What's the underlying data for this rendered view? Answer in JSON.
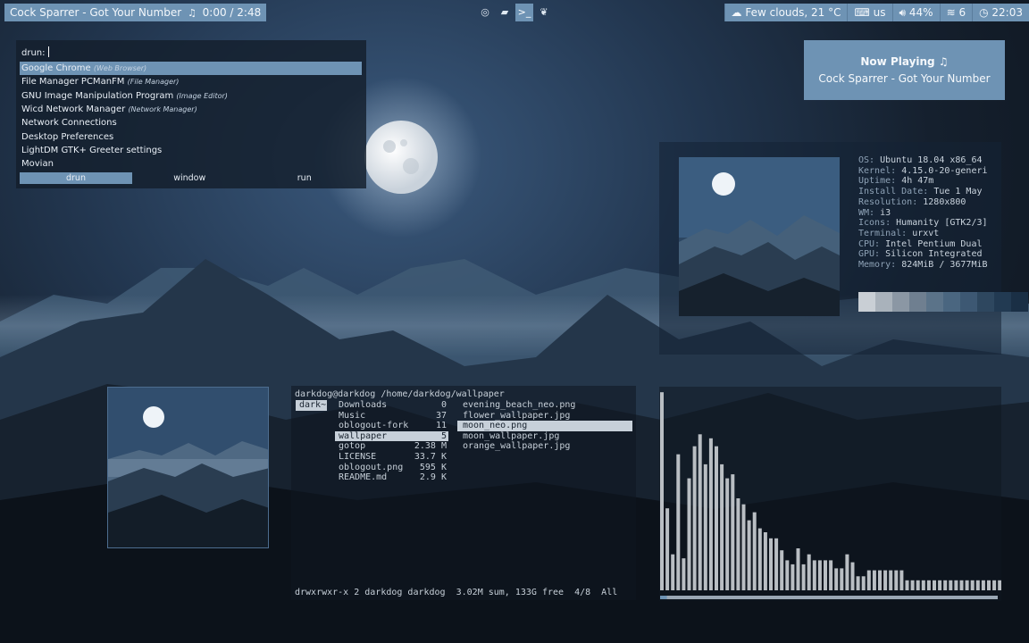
{
  "topbar": {
    "track": "Cock Sparrer - Got Your Number",
    "track_icon": "headphones-icon",
    "time": "0:00 / 2:48",
    "workspaces": [
      {
        "icon": "chrome-icon",
        "glyph": "◎",
        "active": false
      },
      {
        "icon": "folder-icon",
        "glyph": "▰",
        "active": false
      },
      {
        "icon": "terminal-icon",
        "glyph": ">_",
        "active": true
      },
      {
        "icon": "leaf-icon",
        "glyph": "❦",
        "active": false
      }
    ],
    "weather": "Few clouds, 21 °C",
    "keyboard": "us",
    "volume": "44%",
    "wifi": "6",
    "clock": "22:03",
    "accent": "#6e93b4"
  },
  "launcher": {
    "prompt": "drun:",
    "items": [
      {
        "name": "Google Chrome",
        "sub": "(Web Browser)",
        "selected": true
      },
      {
        "name": "File Manager PCManFM",
        "sub": "(File Manager)",
        "selected": false
      },
      {
        "name": "GNU Image Manipulation Program",
        "sub": "(Image Editor)",
        "selected": false
      },
      {
        "name": "Wicd Network Manager",
        "sub": "(Network Manager)",
        "selected": false
      },
      {
        "name": "Network Connections",
        "sub": "",
        "selected": false
      },
      {
        "name": "Desktop Preferences",
        "sub": "",
        "selected": false
      },
      {
        "name": "LightDM GTK+ Greeter settings",
        "sub": "",
        "selected": false
      },
      {
        "name": "Movian",
        "sub": "",
        "selected": false
      }
    ],
    "modes": [
      {
        "label": "drun",
        "selected": true
      },
      {
        "label": "window",
        "selected": false
      },
      {
        "label": "run",
        "selected": false
      }
    ]
  },
  "nowplaying": {
    "heading": "Now Playing",
    "track": "Cock Sparrer - Got Your Number"
  },
  "sysinfo": {
    "lines": [
      {
        "k": "OS:",
        "v": "Ubuntu 18.04 x86_64"
      },
      {
        "k": "Kernel:",
        "v": "4.15.0-20-generi"
      },
      {
        "k": "Uptime:",
        "v": "4h 47m"
      },
      {
        "k": "Install Date:",
        "v": "Tue 1 May"
      },
      {
        "k": "Resolution:",
        "v": "1280x800"
      },
      {
        "k": "WM:",
        "v": "i3"
      },
      {
        "k": "Icons:",
        "v": "Humanity [GTK2/3]"
      },
      {
        "k": "Terminal:",
        "v": "urxvt"
      },
      {
        "k": "CPU:",
        "v": "Intel Pentium Dual"
      },
      {
        "k": "GPU:",
        "v": "Silicon Integrated"
      },
      {
        "k": "Memory:",
        "v": "824MiB / 3677MiB"
      }
    ],
    "swatches": [
      "#c9cfd5",
      "#a9b2bb",
      "#8b97a4",
      "#6f7f90",
      "#5b7389",
      "#4a6680",
      "#3d5873",
      "#2e475f",
      "#223a52",
      "#1a2f45"
    ]
  },
  "ranger": {
    "header": "darkdog@darkdog /home/darkdog/wallpaper",
    "parent": "dark~",
    "middle": [
      {
        "name": "Downloads",
        "count": "0",
        "selected": false
      },
      {
        "name": "Music",
        "count": "37",
        "selected": false
      },
      {
        "name": "oblogout-fork",
        "count": "11",
        "selected": false
      },
      {
        "name": "wallpaper",
        "count": "5",
        "selected": true
      },
      {
        "name": "gotop",
        "count": "2.38 M",
        "selected": false
      },
      {
        "name": "LICENSE",
        "count": "33.7 K",
        "selected": false
      },
      {
        "name": "oblogout.png",
        "count": "595 K",
        "selected": false
      },
      {
        "name": "README.md",
        "count": "2.9 K",
        "selected": false
      }
    ],
    "right": [
      {
        "name": "evening_beach_neo.png",
        "selected": false
      },
      {
        "name": "flower_wallpaper.jpg",
        "selected": false
      },
      {
        "name": "moon_neo.png",
        "selected": true
      },
      {
        "name": "moon_wallpaper.jpg",
        "selected": false
      },
      {
        "name": "orange_wallpaper.jpg",
        "selected": false
      }
    ],
    "footer": "drwxrwxr-x 2 darkdog darkdog  3.02M sum, 133G free  4/8  All"
  },
  "visualizer": {
    "bar_color": "#b9bec3",
    "progress": 0.02,
    "levels": [
      0.99,
      0.41,
      0.18,
      0.68,
      0.16,
      0.56,
      0.72,
      0.78,
      0.63,
      0.76,
      0.72,
      0.63,
      0.56,
      0.58,
      0.46,
      0.43,
      0.35,
      0.39,
      0.31,
      0.29,
      0.26,
      0.26,
      0.2,
      0.15,
      0.13,
      0.21,
      0.13,
      0.18,
      0.15,
      0.15,
      0.15,
      0.15,
      0.11,
      0.11,
      0.18,
      0.14,
      0.07,
      0.07,
      0.1,
      0.1,
      0.1,
      0.1,
      0.1,
      0.1,
      0.1,
      0.05,
      0.05,
      0.05,
      0.05,
      0.05,
      0.05,
      0.05,
      0.05,
      0.05,
      0.05,
      0.05,
      0.05,
      0.05,
      0.05,
      0.05,
      0.05,
      0.05,
      0.05
    ]
  }
}
